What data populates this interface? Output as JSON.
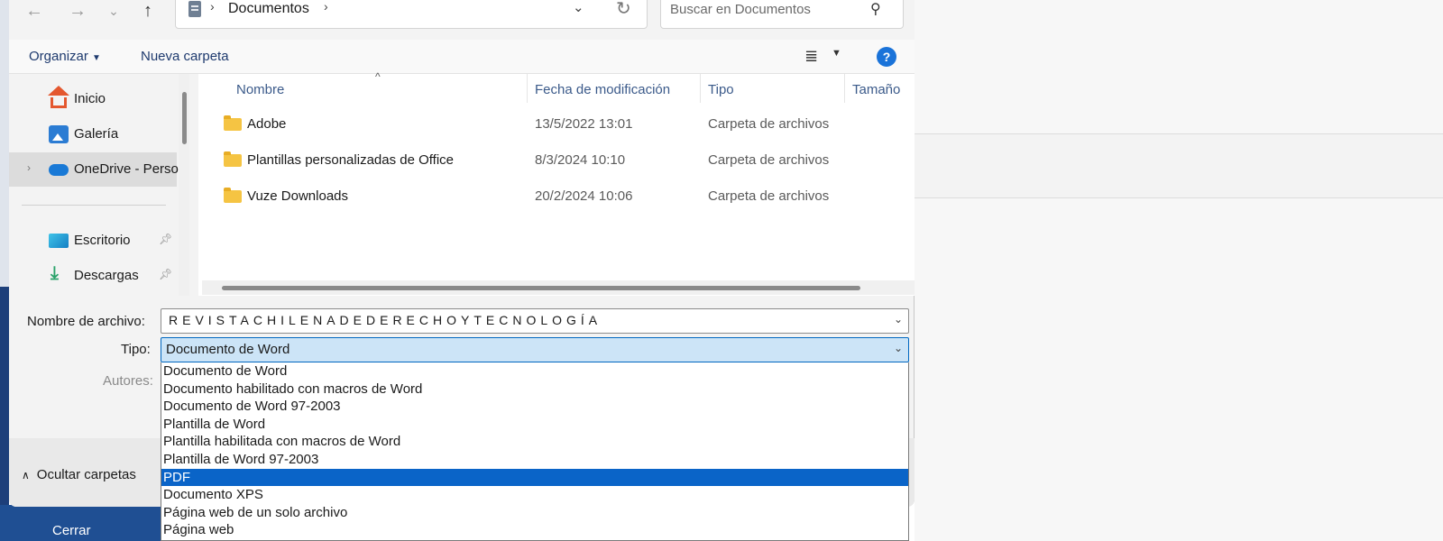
{
  "address_bar": {
    "breadcrumb": "Documentos",
    "search_placeholder": "Buscar en Documentos"
  },
  "toolbar": {
    "organize_label": "Organizar",
    "new_folder_label": "Nueva carpeta",
    "help_label": "?"
  },
  "sidebar": {
    "items": [
      {
        "label": "Inicio",
        "icon": "home-icon"
      },
      {
        "label": "Galería",
        "icon": "gallery-icon"
      },
      {
        "label": "OneDrive - Perso",
        "icon": "cloud-icon",
        "selected": true
      },
      {
        "label": "Escritorio",
        "icon": "desktop-icon",
        "pinned": true
      },
      {
        "label": "Descargas",
        "icon": "download-icon",
        "pinned": true
      }
    ]
  },
  "file_list": {
    "columns": [
      "Nombre",
      "Fecha de modificación",
      "Tipo",
      "Tamaño"
    ],
    "rows": [
      {
        "name": "Adobe",
        "date": "13/5/2022 13:01",
        "type": "Carpeta de archivos"
      },
      {
        "name": "Plantillas personalizadas de Office",
        "date": "8/3/2024 10:10",
        "type": "Carpeta de archivos"
      },
      {
        "name": "Vuze Downloads",
        "date": "20/2/2024 10:06",
        "type": "Carpeta de archivos"
      }
    ]
  },
  "form": {
    "filename_label": "Nombre de archivo:",
    "filename_value": "REVISTACHILENADEDERECHOYTECNOLOGÍA",
    "type_label": "Tipo:",
    "type_value": "Documento de Word",
    "authors_label": "Autores:"
  },
  "type_options": [
    "Documento de Word",
    "Documento habilitado con macros de Word",
    "Documento de Word 97-2003",
    "Plantilla de Word",
    "Plantilla habilitada con macros de Word",
    "Plantilla de Word 97-2003",
    "PDF",
    "Documento XPS",
    "Página web de un solo archivo",
    "Página web"
  ],
  "selected_option": "PDF",
  "bottom": {
    "hide_folders_label": "Ocultar carpetas",
    "cerrar_label": "Cerrar"
  },
  "colors": {
    "accent": "#0067c0",
    "selection": "#0a64c8",
    "link_text": "#1e3a6e"
  }
}
